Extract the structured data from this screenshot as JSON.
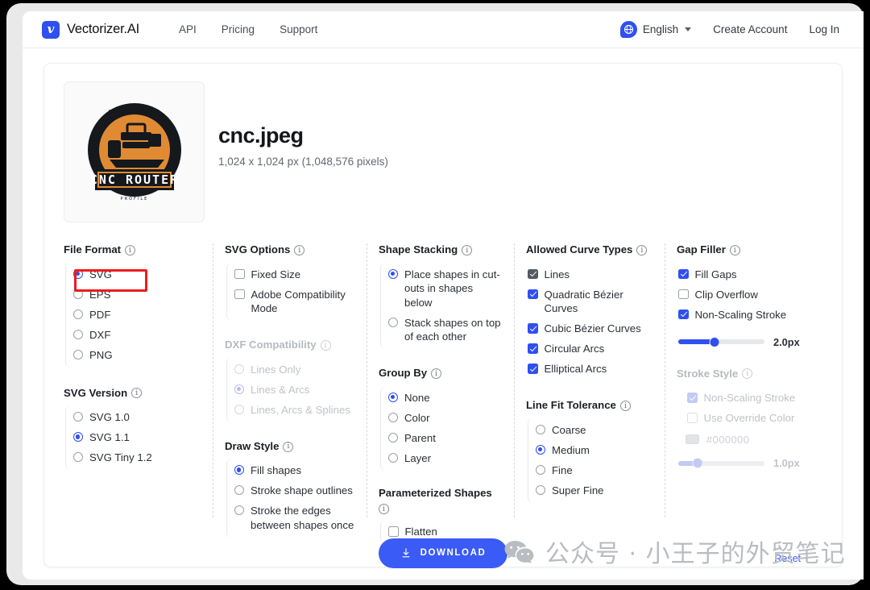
{
  "header": {
    "brand_glyph": "v",
    "brand_name": "Vectorizer.AI",
    "nav": [
      {
        "label": "API"
      },
      {
        "label": "Pricing"
      },
      {
        "label": "Support"
      }
    ],
    "language": {
      "icon": "globe-icon",
      "label": "English"
    },
    "create_account": "Create Account",
    "log_in": "Log In"
  },
  "file": {
    "thumbnail_alt": "cnc-router-logo",
    "name": "cnc.jpeg",
    "dimensions": "1,024 x 1,024 px (1,048,576 pixels)"
  },
  "columns": {
    "file_format": {
      "title": "File Format",
      "options": [
        {
          "label": "SVG",
          "selected": true
        },
        {
          "label": "EPS",
          "selected": false
        },
        {
          "label": "PDF",
          "selected": false
        },
        {
          "label": "DXF",
          "selected": false
        },
        {
          "label": "PNG",
          "selected": false
        }
      ]
    },
    "svg_version": {
      "title": "SVG Version",
      "options": [
        {
          "label": "SVG 1.0",
          "selected": false
        },
        {
          "label": "SVG 1.1",
          "selected": true
        },
        {
          "label": "SVG Tiny 1.2",
          "selected": false
        }
      ]
    },
    "svg_options": {
      "title": "SVG Options",
      "options": [
        {
          "label": "Fixed Size",
          "checked": false
        },
        {
          "label": "Adobe Compatibility Mode",
          "checked": false
        }
      ]
    },
    "dxf_compatibility": {
      "title": "DXF Compatibility",
      "disabled": true,
      "options": [
        {
          "label": "Lines Only",
          "selected": false
        },
        {
          "label": "Lines & Arcs",
          "selected": true
        },
        {
          "label": "Lines, Arcs & Splines",
          "selected": false
        }
      ]
    },
    "draw_style": {
      "title": "Draw Style",
      "options": [
        {
          "label": "Fill shapes",
          "selected": true
        },
        {
          "label": "Stroke shape outlines",
          "selected": false
        },
        {
          "label": "Stroke the edges between shapes once",
          "selected": false
        }
      ]
    },
    "shape_stacking": {
      "title": "Shape Stacking",
      "options": [
        {
          "label": "Place shapes in cut-outs in shapes below",
          "selected": true
        },
        {
          "label": "Stack shapes on top of each other",
          "selected": false
        }
      ]
    },
    "group_by": {
      "title": "Group By",
      "options": [
        {
          "label": "None",
          "selected": true
        },
        {
          "label": "Color",
          "selected": false
        },
        {
          "label": "Parent",
          "selected": false
        },
        {
          "label": "Layer",
          "selected": false
        }
      ]
    },
    "parameterized_shapes": {
      "title": "Parameterized Shapes",
      "options": [
        {
          "label": "Flatten",
          "checked": false
        }
      ]
    },
    "allowed_curve_types": {
      "title": "Allowed Curve Types",
      "options": [
        {
          "label": "Lines",
          "checked": true,
          "locked": true
        },
        {
          "label": "Quadratic Bézier Curves",
          "checked": true
        },
        {
          "label": "Cubic Bézier Curves",
          "checked": true
        },
        {
          "label": "Circular Arcs",
          "checked": true
        },
        {
          "label": "Elliptical Arcs",
          "checked": true
        }
      ]
    },
    "line_fit_tolerance": {
      "title": "Line Fit Tolerance",
      "options": [
        {
          "label": "Coarse",
          "selected": false
        },
        {
          "label": "Medium",
          "selected": true
        },
        {
          "label": "Fine",
          "selected": false
        },
        {
          "label": "Super Fine",
          "selected": false
        }
      ]
    },
    "gap_filler": {
      "title": "Gap Filler",
      "options": [
        {
          "label": "Fill Gaps",
          "checked": true
        },
        {
          "label": "Clip Overflow",
          "checked": false
        },
        {
          "label": "Non-Scaling Stroke",
          "checked": true
        }
      ],
      "slider": {
        "value": "2.0px",
        "percent": 42
      }
    },
    "stroke_style": {
      "title": "Stroke Style",
      "disabled": true,
      "options": [
        {
          "label": "Non-Scaling Stroke",
          "checked": true
        },
        {
          "label": "Use Override Color",
          "checked": false
        }
      ],
      "color_value": "#000000",
      "slider": {
        "value": "1.0px",
        "percent": 22
      }
    }
  },
  "footer": {
    "download_label": "DOWNLOAD",
    "download_icon": "download-icon",
    "reset_label": "Reset"
  },
  "watermark": {
    "icon": "wechat-icon",
    "text": "公众号 · 小王子的外贸笔记"
  },
  "colors": {
    "accent": "#2f4ff0",
    "download_button": "#3a5bf5",
    "annotation": "#ee1b1b"
  }
}
